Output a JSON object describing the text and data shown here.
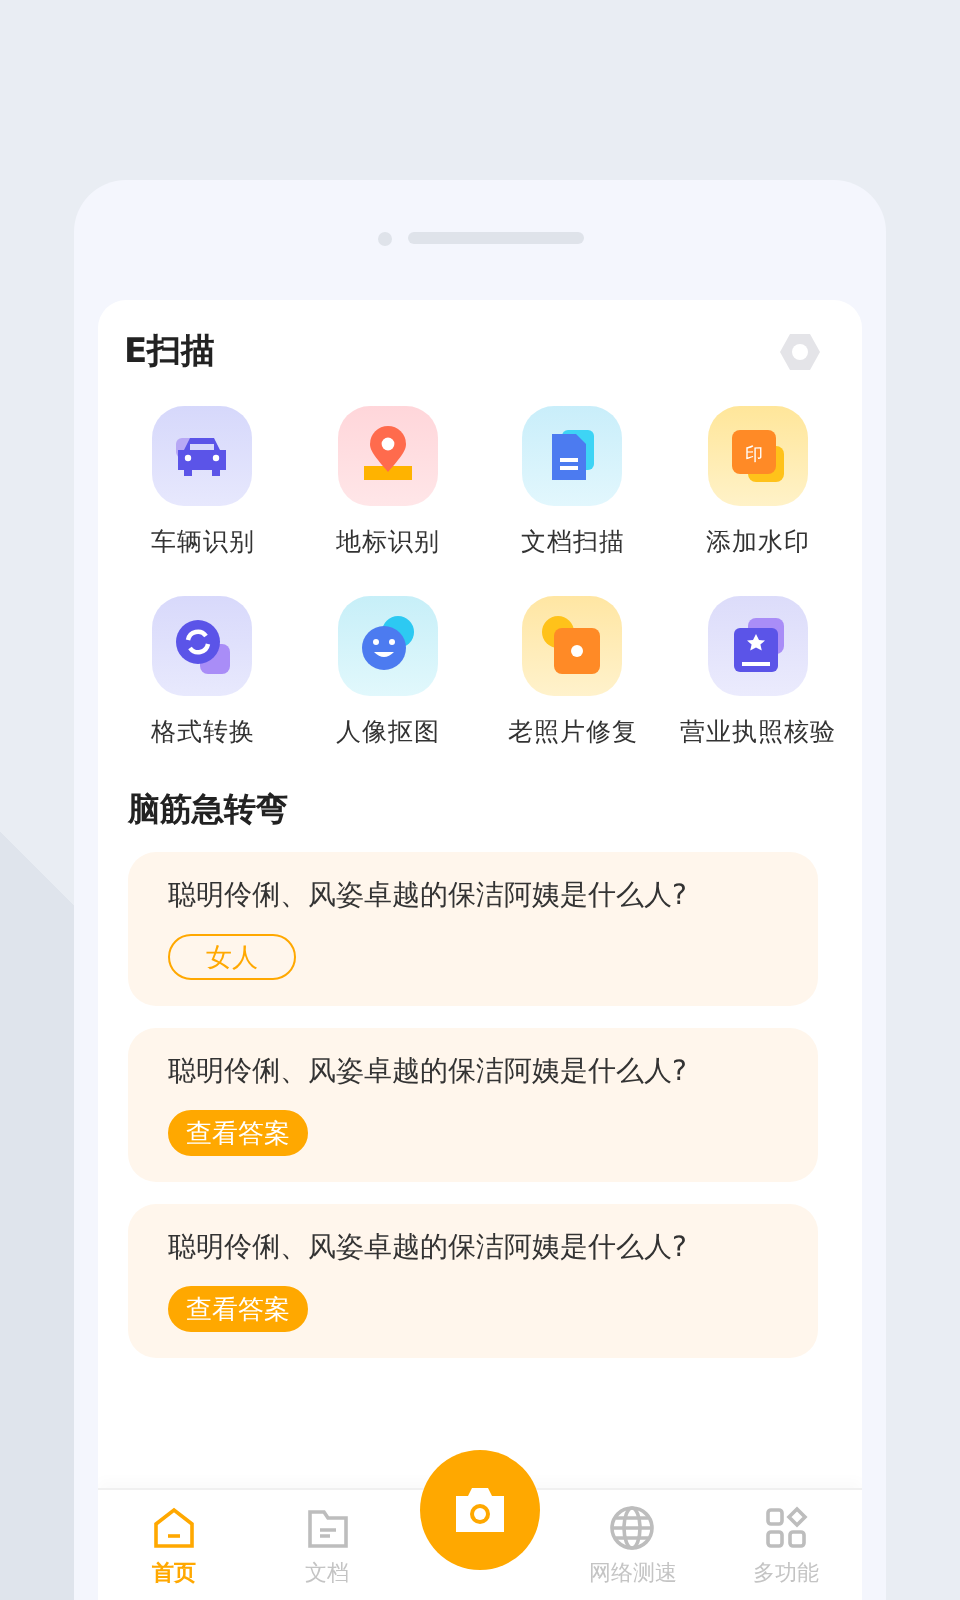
{
  "app": {
    "title": "E扫描"
  },
  "tools": [
    {
      "label": "车辆识别",
      "kind": "car"
    },
    {
      "label": "地标识别",
      "kind": "location"
    },
    {
      "label": "文档扫描",
      "kind": "document"
    },
    {
      "label": "添加水印",
      "kind": "watermark",
      "stamp": "印"
    },
    {
      "label": "格式转换",
      "kind": "convert"
    },
    {
      "label": "人像抠图",
      "kind": "portrait"
    },
    {
      "label": "老照片修复",
      "kind": "photo"
    },
    {
      "label": "营业执照核验",
      "kind": "license"
    }
  ],
  "riddles": {
    "title": "脑筋急转弯",
    "items": [
      {
        "question": "聪明伶俐、风姿卓越的保洁阿姨是什么人?",
        "revealed": true,
        "answer": "女人"
      },
      {
        "question": "聪明伶俐、风姿卓越的保洁阿姨是什么人?",
        "revealed": false,
        "button": "查看答案"
      },
      {
        "question": "聪明伶俐、风姿卓越的保洁阿姨是什么人?",
        "revealed": false,
        "button": "查看答案"
      }
    ]
  },
  "nav": [
    {
      "label": "首页",
      "kind": "home",
      "selected": true
    },
    {
      "label": "文档",
      "kind": "folder",
      "selected": false
    },
    {
      "label": "网络测速",
      "kind": "globe",
      "selected": false
    },
    {
      "label": "多功能",
      "kind": "apps",
      "selected": false
    }
  ]
}
